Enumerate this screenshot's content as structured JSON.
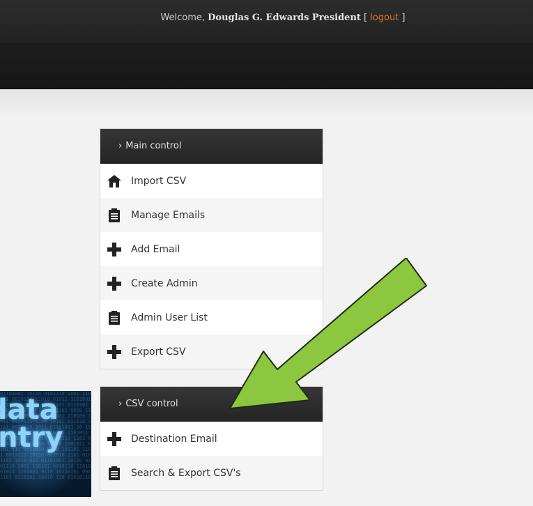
{
  "header": {
    "welcome_prefix": "Welcome, ",
    "user_name": "Douglas G. Edwards President",
    "bracket_open": " [ ",
    "logout_label": "logout",
    "bracket_close": " ]"
  },
  "main_control": {
    "chevron": "›",
    "title": "Main control",
    "items": [
      {
        "label": "Import CSV",
        "icon": "home-icon"
      },
      {
        "label": "Manage Emails",
        "icon": "clipboard-icon"
      },
      {
        "label": "Add Email",
        "icon": "plus-icon"
      },
      {
        "label": "Create Admin",
        "icon": "plus-icon"
      },
      {
        "label": "Admin User List",
        "icon": "clipboard-icon"
      },
      {
        "label": "Export CSV",
        "icon": "plus-icon"
      }
    ]
  },
  "csv_control": {
    "chevron": "›",
    "title": "CSV control",
    "items": [
      {
        "label": "Destination Email",
        "icon": "plus-icon"
      },
      {
        "label": "Search & Export CSV's",
        "icon": "clipboard-icon"
      }
    ]
  },
  "image": {
    "line1": "data",
    "line2": "entry"
  },
  "colors": {
    "accent_logout": "#e8731f",
    "arrow_fill": "#8dc63f",
    "header_bg": "#242424"
  }
}
